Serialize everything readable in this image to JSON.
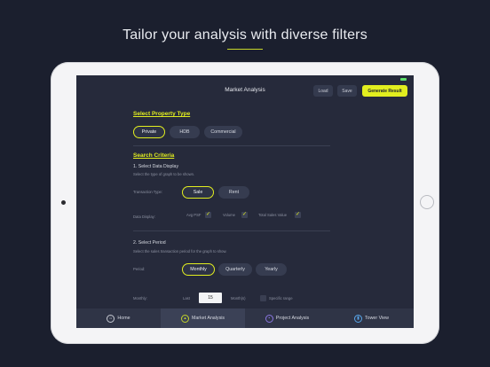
{
  "promo": {
    "headline": "Tailor your analysis with diverse filters"
  },
  "toolbar": {
    "title": "Market Analysis",
    "load_label": "Load",
    "save_label": "Save",
    "generate_label": "Generate Result"
  },
  "property_type": {
    "title": "Select Property Type",
    "options": [
      "Private",
      "HDB",
      "Commercial"
    ],
    "selected": "Private"
  },
  "search_criteria": {
    "title": "Search Criteria",
    "step1_title": "1. Select Data Display",
    "step1_hint": "Select the type of graph to be shown.",
    "transaction_type_label": "Transaction Type:",
    "transaction_options": [
      "Sale",
      "Rent"
    ],
    "transaction_selected": "Sale",
    "data_display_label": "Data Display:",
    "data_display_options": [
      {
        "label": "Avg PSF",
        "checked": true
      },
      {
        "label": "Volume",
        "checked": true
      },
      {
        "label": "Total Sales Value",
        "checked": true
      }
    ],
    "step2_title": "2. Select Period",
    "step2_hint": "Select the sales transaction period for the graph to show.",
    "period_label": "Period:",
    "period_options": [
      "Monthly",
      "Quarterly",
      "Yearly"
    ],
    "period_selected": "Monthly",
    "monthly_label": "Monthly:",
    "last_label": "Last",
    "last_value": "15",
    "months_label": "Month(s)",
    "specific_range_label": "Specific range",
    "specific_range_checked": false
  },
  "tabbar": {
    "items": [
      {
        "label": "Home",
        "icon": "home-icon"
      },
      {
        "label": "Market Analysis",
        "icon": "market-analysis-icon"
      },
      {
        "label": "Project Analysis",
        "icon": "project-analysis-icon"
      },
      {
        "label": "Tower View",
        "icon": "tower-view-icon"
      }
    ],
    "active": "Market Analysis"
  },
  "colors": {
    "accent": "#e2ee1f",
    "background": "#262a3b"
  }
}
